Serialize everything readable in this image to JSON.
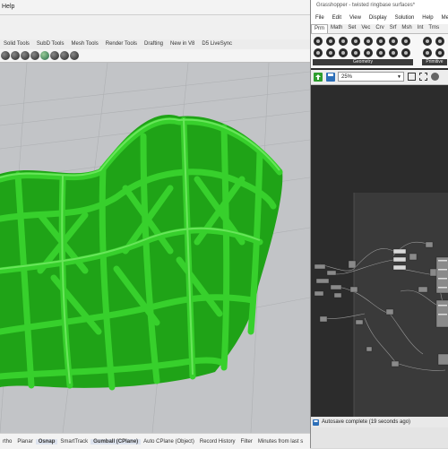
{
  "rhino": {
    "menu": {
      "help_label": "Help"
    },
    "tabs": [
      "Solid Tools",
      "SubD Tools",
      "Mesh Tools",
      "Render Tools",
      "Drafting",
      "New in V8",
      "D5 LiveSync"
    ],
    "status": {
      "items": [
        "rtho",
        "Planar",
        "Osnap",
        "SmartTrack",
        "Gumball (CPlane)",
        "Auto CPlane (Object)",
        "Record History",
        "Filter",
        "Minutes from last s"
      ]
    },
    "colors": {
      "mesh": "#22b61a",
      "viewport_bg": "#c2c4c7"
    }
  },
  "grasshopper": {
    "window_title": "Grasshopper - twisted ringbase surfaces*",
    "menu": [
      "File",
      "Edit",
      "View",
      "Display",
      "Solution",
      "Help",
      "Metah"
    ],
    "tabs": [
      "Prm",
      "Math",
      "Set",
      "Vec",
      "Crv",
      "Srf",
      "Msh",
      "Int",
      "Trns"
    ],
    "palette_groups": {
      "geometry": "Geometry",
      "primitive": "Primitive"
    },
    "zoom_value": "25%",
    "status_text": "Autosave complete (19 seconds ago)"
  }
}
